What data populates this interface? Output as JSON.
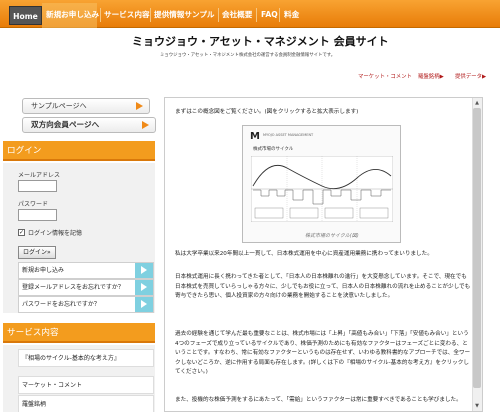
{
  "nav": {
    "items": [
      "Home",
      "新規お申し込み",
      "サービス内容",
      "提供情報サンプル",
      "会社概要",
      "FAQ",
      "料金"
    ]
  },
  "site": {
    "title": "ミョウジョウ・アセット・マネジメント 会員サイト",
    "subtitle": "ミョウジョウ・アセット・マネジメント株式会社の運営する会員制金融情報サイトです。"
  },
  "quick_links": [
    "マーケット・コメント",
    "羅盤銘柄▶",
    "提供データ▶"
  ],
  "sidebar": {
    "sample_button": "サンプルページへ",
    "member_button": "双方向会員ページへ",
    "login": {
      "heading": "ログイン",
      "email_label": "メールアドレス",
      "password_label": "パスワード",
      "remember_label": "ログイン情報を記憶",
      "login_button": "ログイン»"
    },
    "links": [
      "新規お申し込み",
      "登録メールアドレスをお忘れですか？",
      "パスワードをお忘れですか？"
    ],
    "services_heading": "サービス内容",
    "services": [
      "『相場のサイクル-基本的な考え方』",
      "マーケット・コメント",
      "羅盤銘柄"
    ]
  },
  "content": {
    "intro": "まずはこの概念図をご覧ください。(図をクリックすると拡大表示します)",
    "figure": {
      "logo": "M",
      "logo_text": "MYOJO ASSET MANAGEMENT",
      "title": "株式市場のサイクル",
      "caption": "株式市場のサイクル(図)"
    },
    "paragraphs": [
      "私は大学卒業以来20年間以上一貫して、日本株式運用を中心に資産運用業務に携わってまいりました。",
      "日本株式運用に長く携わってきた者として、「日本人の日本株離れの進行」を大変懸念しています。そこで、現在でも日本株式を売買していらっしゃる方々に、少しでもお役に立って、日本人の日本株離れの流れを止めることが少しでも寄与できたら思い、個人投資家の方々向けの業務を開始することを決意いたしました。",
      "過去の経験を通じて学んだ最も重要なことは、株式市場には「上昇」「高値もみ合い」「下落」「安値もみ合い」という4つのフェーズで成り立っているサイクルであり、株価予測のためにも有効なファクターはフェーズごとに変わる、ということです。すなわち、常に有効なファクターというものは存在せず、いわゆる教科書的なアプローチでは、全ワークしないどころか、逆に作用する局面も存在します。(詳しくは下の『相場のサイクル-基本的な考え方』をクリックしてください。)",
      "また、投機的な株価予測をするにあたって、「需給」というファクターは常に重要すべきであることも学びました。"
    ]
  }
}
